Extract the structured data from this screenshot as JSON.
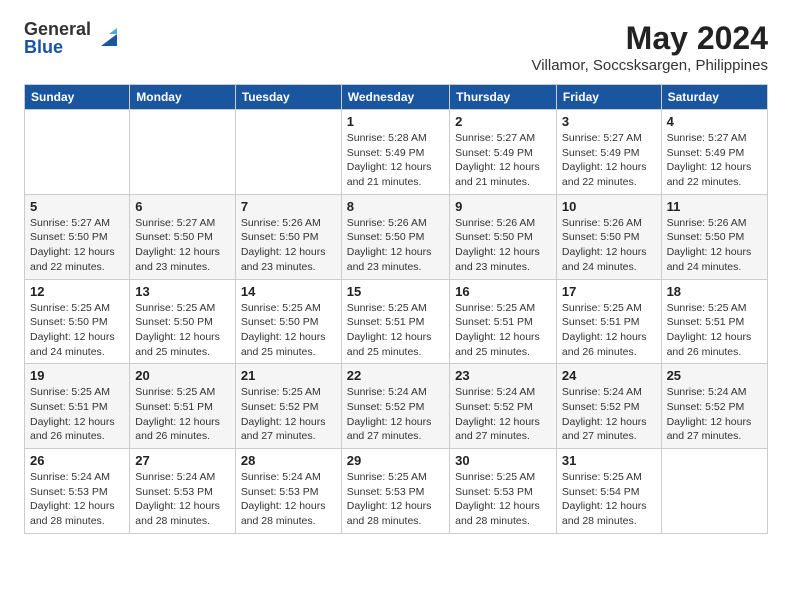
{
  "logo": {
    "general": "General",
    "blue": "Blue"
  },
  "title": "May 2024",
  "subtitle": "Villamor, Soccsksargen, Philippines",
  "days_of_week": [
    "Sunday",
    "Monday",
    "Tuesday",
    "Wednesday",
    "Thursday",
    "Friday",
    "Saturday"
  ],
  "weeks": [
    [
      {
        "num": "",
        "info": ""
      },
      {
        "num": "",
        "info": ""
      },
      {
        "num": "",
        "info": ""
      },
      {
        "num": "1",
        "info": "Sunrise: 5:28 AM\nSunset: 5:49 PM\nDaylight: 12 hours\nand 21 minutes."
      },
      {
        "num": "2",
        "info": "Sunrise: 5:27 AM\nSunset: 5:49 PM\nDaylight: 12 hours\nand 21 minutes."
      },
      {
        "num": "3",
        "info": "Sunrise: 5:27 AM\nSunset: 5:49 PM\nDaylight: 12 hours\nand 22 minutes."
      },
      {
        "num": "4",
        "info": "Sunrise: 5:27 AM\nSunset: 5:49 PM\nDaylight: 12 hours\nand 22 minutes."
      }
    ],
    [
      {
        "num": "5",
        "info": "Sunrise: 5:27 AM\nSunset: 5:50 PM\nDaylight: 12 hours\nand 22 minutes."
      },
      {
        "num": "6",
        "info": "Sunrise: 5:27 AM\nSunset: 5:50 PM\nDaylight: 12 hours\nand 23 minutes."
      },
      {
        "num": "7",
        "info": "Sunrise: 5:26 AM\nSunset: 5:50 PM\nDaylight: 12 hours\nand 23 minutes."
      },
      {
        "num": "8",
        "info": "Sunrise: 5:26 AM\nSunset: 5:50 PM\nDaylight: 12 hours\nand 23 minutes."
      },
      {
        "num": "9",
        "info": "Sunrise: 5:26 AM\nSunset: 5:50 PM\nDaylight: 12 hours\nand 23 minutes."
      },
      {
        "num": "10",
        "info": "Sunrise: 5:26 AM\nSunset: 5:50 PM\nDaylight: 12 hours\nand 24 minutes."
      },
      {
        "num": "11",
        "info": "Sunrise: 5:26 AM\nSunset: 5:50 PM\nDaylight: 12 hours\nand 24 minutes."
      }
    ],
    [
      {
        "num": "12",
        "info": "Sunrise: 5:25 AM\nSunset: 5:50 PM\nDaylight: 12 hours\nand 24 minutes."
      },
      {
        "num": "13",
        "info": "Sunrise: 5:25 AM\nSunset: 5:50 PM\nDaylight: 12 hours\nand 25 minutes."
      },
      {
        "num": "14",
        "info": "Sunrise: 5:25 AM\nSunset: 5:50 PM\nDaylight: 12 hours\nand 25 minutes."
      },
      {
        "num": "15",
        "info": "Sunrise: 5:25 AM\nSunset: 5:51 PM\nDaylight: 12 hours\nand 25 minutes."
      },
      {
        "num": "16",
        "info": "Sunrise: 5:25 AM\nSunset: 5:51 PM\nDaylight: 12 hours\nand 25 minutes."
      },
      {
        "num": "17",
        "info": "Sunrise: 5:25 AM\nSunset: 5:51 PM\nDaylight: 12 hours\nand 26 minutes."
      },
      {
        "num": "18",
        "info": "Sunrise: 5:25 AM\nSunset: 5:51 PM\nDaylight: 12 hours\nand 26 minutes."
      }
    ],
    [
      {
        "num": "19",
        "info": "Sunrise: 5:25 AM\nSunset: 5:51 PM\nDaylight: 12 hours\nand 26 minutes."
      },
      {
        "num": "20",
        "info": "Sunrise: 5:25 AM\nSunset: 5:51 PM\nDaylight: 12 hours\nand 26 minutes."
      },
      {
        "num": "21",
        "info": "Sunrise: 5:25 AM\nSunset: 5:52 PM\nDaylight: 12 hours\nand 27 minutes."
      },
      {
        "num": "22",
        "info": "Sunrise: 5:24 AM\nSunset: 5:52 PM\nDaylight: 12 hours\nand 27 minutes."
      },
      {
        "num": "23",
        "info": "Sunrise: 5:24 AM\nSunset: 5:52 PM\nDaylight: 12 hours\nand 27 minutes."
      },
      {
        "num": "24",
        "info": "Sunrise: 5:24 AM\nSunset: 5:52 PM\nDaylight: 12 hours\nand 27 minutes."
      },
      {
        "num": "25",
        "info": "Sunrise: 5:24 AM\nSunset: 5:52 PM\nDaylight: 12 hours\nand 27 minutes."
      }
    ],
    [
      {
        "num": "26",
        "info": "Sunrise: 5:24 AM\nSunset: 5:53 PM\nDaylight: 12 hours\nand 28 minutes."
      },
      {
        "num": "27",
        "info": "Sunrise: 5:24 AM\nSunset: 5:53 PM\nDaylight: 12 hours\nand 28 minutes."
      },
      {
        "num": "28",
        "info": "Sunrise: 5:24 AM\nSunset: 5:53 PM\nDaylight: 12 hours\nand 28 minutes."
      },
      {
        "num": "29",
        "info": "Sunrise: 5:25 AM\nSunset: 5:53 PM\nDaylight: 12 hours\nand 28 minutes."
      },
      {
        "num": "30",
        "info": "Sunrise: 5:25 AM\nSunset: 5:53 PM\nDaylight: 12 hours\nand 28 minutes."
      },
      {
        "num": "31",
        "info": "Sunrise: 5:25 AM\nSunset: 5:54 PM\nDaylight: 12 hours\nand 28 minutes."
      },
      {
        "num": "",
        "info": ""
      }
    ]
  ]
}
